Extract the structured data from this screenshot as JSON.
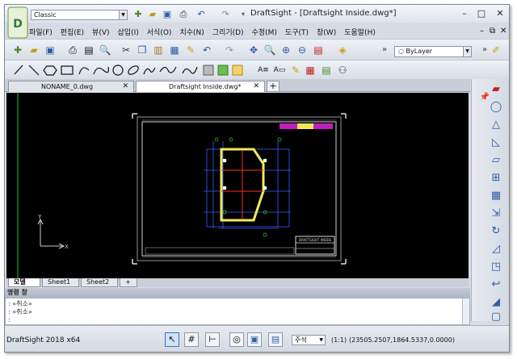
{
  "app": {
    "window_title": "DraftSight - [Draftsight Inside.dwg*]",
    "workspace": "Classic",
    "minimize": "–",
    "restore": "□",
    "close": "✕"
  },
  "quick_access": [
    "new-icon",
    "open-icon",
    "save-icon",
    "print-icon",
    "undo-icon",
    "redo-icon"
  ],
  "menu": [
    "파일(F)",
    "편집(E)",
    "뷰(V)",
    "삽입(I)",
    "서식(O)",
    "치수(N)",
    "그리기(D)",
    "수정(M)",
    "도구(T)",
    "창(W)",
    "도움말(H)"
  ],
  "layer": {
    "current": "ByLayer"
  },
  "tabs": [
    {
      "label": "NONAME_0.dwg",
      "close": "✕"
    },
    {
      "label": "Draftsight Inside.dwg*",
      "close": "✕"
    }
  ],
  "tab_add": "+",
  "sheets": [
    "모델",
    "Sheet1",
    "Sheet2",
    "+"
  ],
  "drawing": {
    "title_block": "DRAFTSIGHT INSIDE",
    "axis_x": "X",
    "axis_y": "Y"
  },
  "command": {
    "header": "명령 창",
    "lines": [
      ": «취소»",
      ": «취소»",
      ":"
    ]
  },
  "status": {
    "app_name": "DraftSight 2018 x64",
    "annotation_scale": "주석",
    "scale": "(1:1)",
    "coords": "(23505.2507,1864.5337,0.0000)"
  },
  "colors": {
    "accent": "#3d6fb6",
    "canvas": "#000000",
    "drawing_yellow": "#f2e85a",
    "drawing_blue": "#3a5cff",
    "drawing_red": "#ff2a2a",
    "axis_green": "#18c418"
  }
}
